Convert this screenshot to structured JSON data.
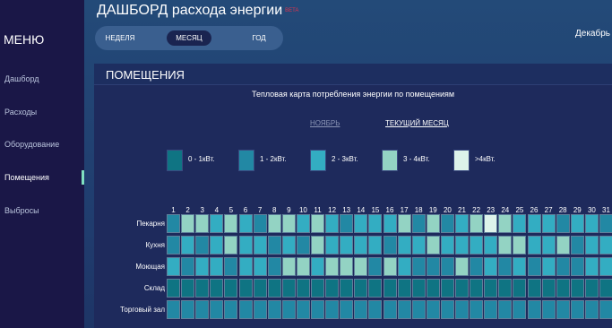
{
  "sidebar": {
    "title": "МЕНЮ",
    "items": [
      {
        "label": "Дашборд",
        "active": false
      },
      {
        "label": "Расходы",
        "active": false
      },
      {
        "label": "Оборудование",
        "active": false
      },
      {
        "label": "Помещения",
        "active": true
      },
      {
        "label": "Выбросы",
        "active": false
      }
    ]
  },
  "header": {
    "title": "ДАШБОРД расхода энергии",
    "badge": "BETA",
    "month": "Декабрь"
  },
  "period_toggle": {
    "options": [
      "НЕДЕЛЯ",
      "МЕСЯЦ",
      "ГОД"
    ],
    "selected": "МЕСЯЦ"
  },
  "panel": {
    "title": "ПОМЕЩЕНИЯ",
    "chart_title": "Тепловая карта потребления энергии по помещениям",
    "links": {
      "previous": "НОЯБРЬ",
      "current": "ТЕКУЩИЙ МЕСЯЦ"
    }
  },
  "legend": [
    {
      "label": "0 - 1кВт.",
      "color": "#0f7483"
    },
    {
      "label": "1 - 2кВт.",
      "color": "#2288a4"
    },
    {
      "label": "2 - 3кВт.",
      "color": "#33adc2"
    },
    {
      "label": "3 - 4кВт.",
      "color": "#93d3c3"
    },
    {
      "label": ">4кВт.",
      "color": "#ddf3ea"
    }
  ],
  "chart_data": {
    "type": "heatmap",
    "title": "Тепловая карта потребления энергии по помещениям",
    "x": [
      "1",
      "2",
      "3",
      "4",
      "5",
      "6",
      "7",
      "8",
      "9",
      "10",
      "11",
      "12",
      "13",
      "14",
      "15",
      "16",
      "17",
      "18",
      "19",
      "20",
      "21",
      "22",
      "23",
      "24",
      "25",
      "26",
      "27",
      "28",
      "29",
      "30",
      "31"
    ],
    "rows": [
      "Пекарня",
      "Кухня",
      "Моющая",
      "Склад",
      "Торговый зал"
    ],
    "levels": [
      [
        1,
        3,
        3,
        2,
        3,
        2,
        1,
        3,
        3,
        2,
        3,
        2,
        1,
        2,
        2,
        2,
        3,
        1,
        3,
        1,
        2,
        3,
        4,
        3,
        2,
        2,
        2,
        1,
        2,
        2,
        1
      ],
      [
        1,
        2,
        1,
        2,
        3,
        2,
        2,
        1,
        2,
        1,
        3,
        2,
        2,
        2,
        2,
        1,
        2,
        2,
        3,
        2,
        2,
        2,
        2,
        3,
        3,
        2,
        2,
        3,
        1,
        2,
        2
      ],
      [
        2,
        1,
        2,
        2,
        1,
        2,
        2,
        1,
        3,
        3,
        2,
        3,
        3,
        3,
        1,
        3,
        2,
        1,
        1,
        1,
        3,
        1,
        2,
        1,
        2,
        1,
        2,
        1,
        1,
        2,
        2
      ],
      [
        0,
        0,
        0,
        0,
        0,
        0,
        0,
        0,
        0,
        0,
        0,
        0,
        0,
        0,
        0,
        0,
        0,
        0,
        0,
        0,
        0,
        0,
        0,
        0,
        0,
        0,
        0,
        0,
        0,
        0,
        0
      ],
      [
        1,
        1,
        1,
        1,
        1,
        1,
        1,
        1,
        1,
        1,
        1,
        1,
        1,
        1,
        1,
        1,
        1,
        1,
        1,
        1,
        1,
        1,
        1,
        1,
        1,
        1,
        1,
        1,
        1,
        1,
        1
      ]
    ],
    "level_labels": [
      "0 - 1кВт.",
      "1 - 2кВт.",
      "2 - 3кВт.",
      "3 - 4кВт.",
      ">4кВт."
    ],
    "colors": [
      "#0f7483",
      "#2288a4",
      "#33adc2",
      "#93d3c3",
      "#ddf3ea"
    ]
  }
}
